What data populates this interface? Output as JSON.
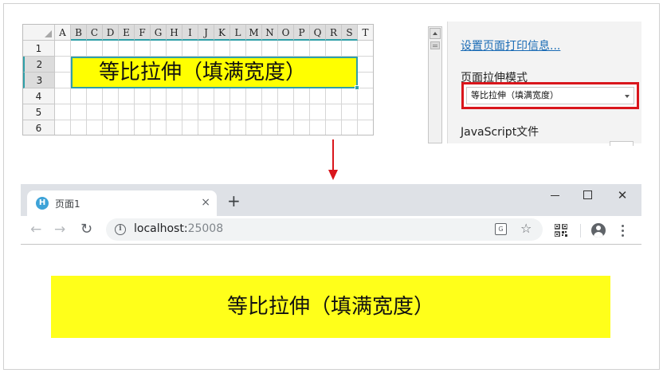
{
  "sheet": {
    "columns": [
      "A",
      "B",
      "C",
      "D",
      "E",
      "F",
      "G",
      "H",
      "I",
      "J",
      "K",
      "L",
      "M",
      "N",
      "O",
      "P",
      "Q",
      "R",
      "S",
      "T"
    ],
    "rows": [
      "1",
      "2",
      "3",
      "4",
      "5",
      "6"
    ],
    "selected_columns": [
      "B",
      "C",
      "D",
      "E",
      "F",
      "G",
      "H",
      "I",
      "J",
      "K",
      "L",
      "M",
      "N",
      "O",
      "P",
      "Q",
      "R",
      "S"
    ],
    "selected_rows": [
      "2",
      "3"
    ],
    "merged_cell_text": "等比拉伸（填满宽度）",
    "merged_cell_fill": "#ffff00",
    "selection_color": "#2f9fa8"
  },
  "panel": {
    "print_settings_link": "设置页面打印信息...",
    "stretch_mode_label": "页面拉伸模式",
    "stretch_mode_value": "等比拉伸（填满宽度）",
    "javascript_label": "JavaScript文件",
    "highlight_color": "#d9161c"
  },
  "arrow": {
    "icon": "arrow-down-icon",
    "color": "#d9161c"
  },
  "browser": {
    "tab_title": "页面1",
    "tab_favicon": "H",
    "tab_close": "×",
    "new_tab": "+",
    "window_close": "✕",
    "back": "←",
    "forward": "→",
    "reload": "↻",
    "info_glyph": "i",
    "url_host": "localhost:",
    "url_port": "25008",
    "translate_glyph": "G",
    "star": "☆",
    "page_text": "等比拉伸（填满宽度）",
    "page_fill": "#ffff1a"
  }
}
